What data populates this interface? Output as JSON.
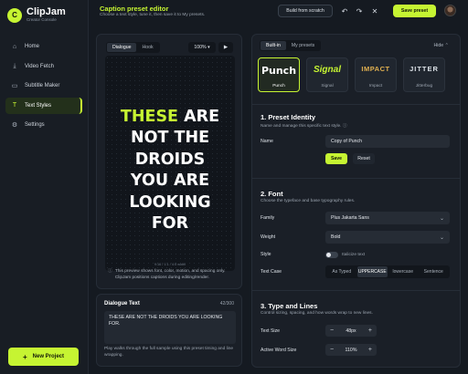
{
  "brand": {
    "logo_letter": "C",
    "name": "ClipJam",
    "subtitle": "Creator Console"
  },
  "sidebar": {
    "items": [
      {
        "label": "Home",
        "icon": "home-icon",
        "glyph": "⌂"
      },
      {
        "label": "Video Fetch",
        "icon": "download-icon",
        "glyph": "⤓"
      },
      {
        "label": "Subtitle Maker",
        "icon": "subtitle-icon",
        "glyph": "▭"
      },
      {
        "label": "Text Styles",
        "icon": "text-style-icon",
        "glyph": "T",
        "active": true
      },
      {
        "label": "Settings",
        "icon": "gear-icon",
        "glyph": "⚙"
      }
    ],
    "new_project": "New Project"
  },
  "header": {
    "title": "Caption preset editor",
    "subtitle": "Choose a text style, tune it, then save it to My presets.",
    "build_from_scratch": "Build from scratch",
    "save_preset": "Save preset"
  },
  "preview": {
    "tabs": [
      "Dialogue",
      "Hook"
    ],
    "active_tab": "Dialogue",
    "zoom": "100%",
    "caption_highlight": "THESE",
    "caption_lines": [
      " ARE",
      "NOT THE",
      "DROIDS",
      "YOU ARE",
      "LOOKING",
      "FOR"
    ],
    "canvas_footer": "9:16 / 1:1 / 4:5 width",
    "note": "This preview shows font, color, motion, and spacing only. ClipJam positions captions during editing/render."
  },
  "dialogue": {
    "title": "Dialogue Text",
    "count": "42/300",
    "text": "THESE ARE NOT THE DROIDS YOU ARE LOOKING FOR.",
    "help": "Play walks through the full sample using this preset timing and line wrapping."
  },
  "right": {
    "tabs": [
      "Built-in",
      "My presets"
    ],
    "active_tab": "Built-in",
    "hide": "Hide",
    "presets": [
      {
        "preview": "Punch",
        "name": "Punch",
        "active": true
      },
      {
        "preview": "Signal",
        "name": "Signal"
      },
      {
        "preview": "IMPACT",
        "name": "Impact"
      },
      {
        "preview": "JITTER",
        "name": "Jitterbug"
      }
    ],
    "identity": {
      "title": "1. Preset Identity",
      "subtitle": "Name and manage this specific text style.",
      "name_label": "Name",
      "name_value": "Copy of Punch",
      "save": "Save",
      "reset": "Reset"
    },
    "font": {
      "title": "2. Font",
      "subtitle": "Choose the typeface and base typography rules.",
      "family_label": "Family",
      "family_value": "Plus Jakarta Sans",
      "weight_label": "Weight",
      "weight_value": "Bold",
      "style_label": "Style",
      "italicize": "Italicize text",
      "case_label": "Text Case",
      "case_options": [
        "As Typed",
        "UPPERCASE",
        "lowercase",
        "Sentence"
      ],
      "case_active": "UPPERCASE"
    },
    "type_lines": {
      "title": "3. Type and Lines",
      "subtitle": "Control sizing, spacing, and how words wrap to new lines.",
      "size_label": "Text Size",
      "size_value": "48px",
      "active_label": "Active Word Size",
      "active_value": "110%"
    }
  },
  "colors": {
    "accent": "#c6f432",
    "background": "#151a21",
    "panel": "#1a1f27"
  }
}
